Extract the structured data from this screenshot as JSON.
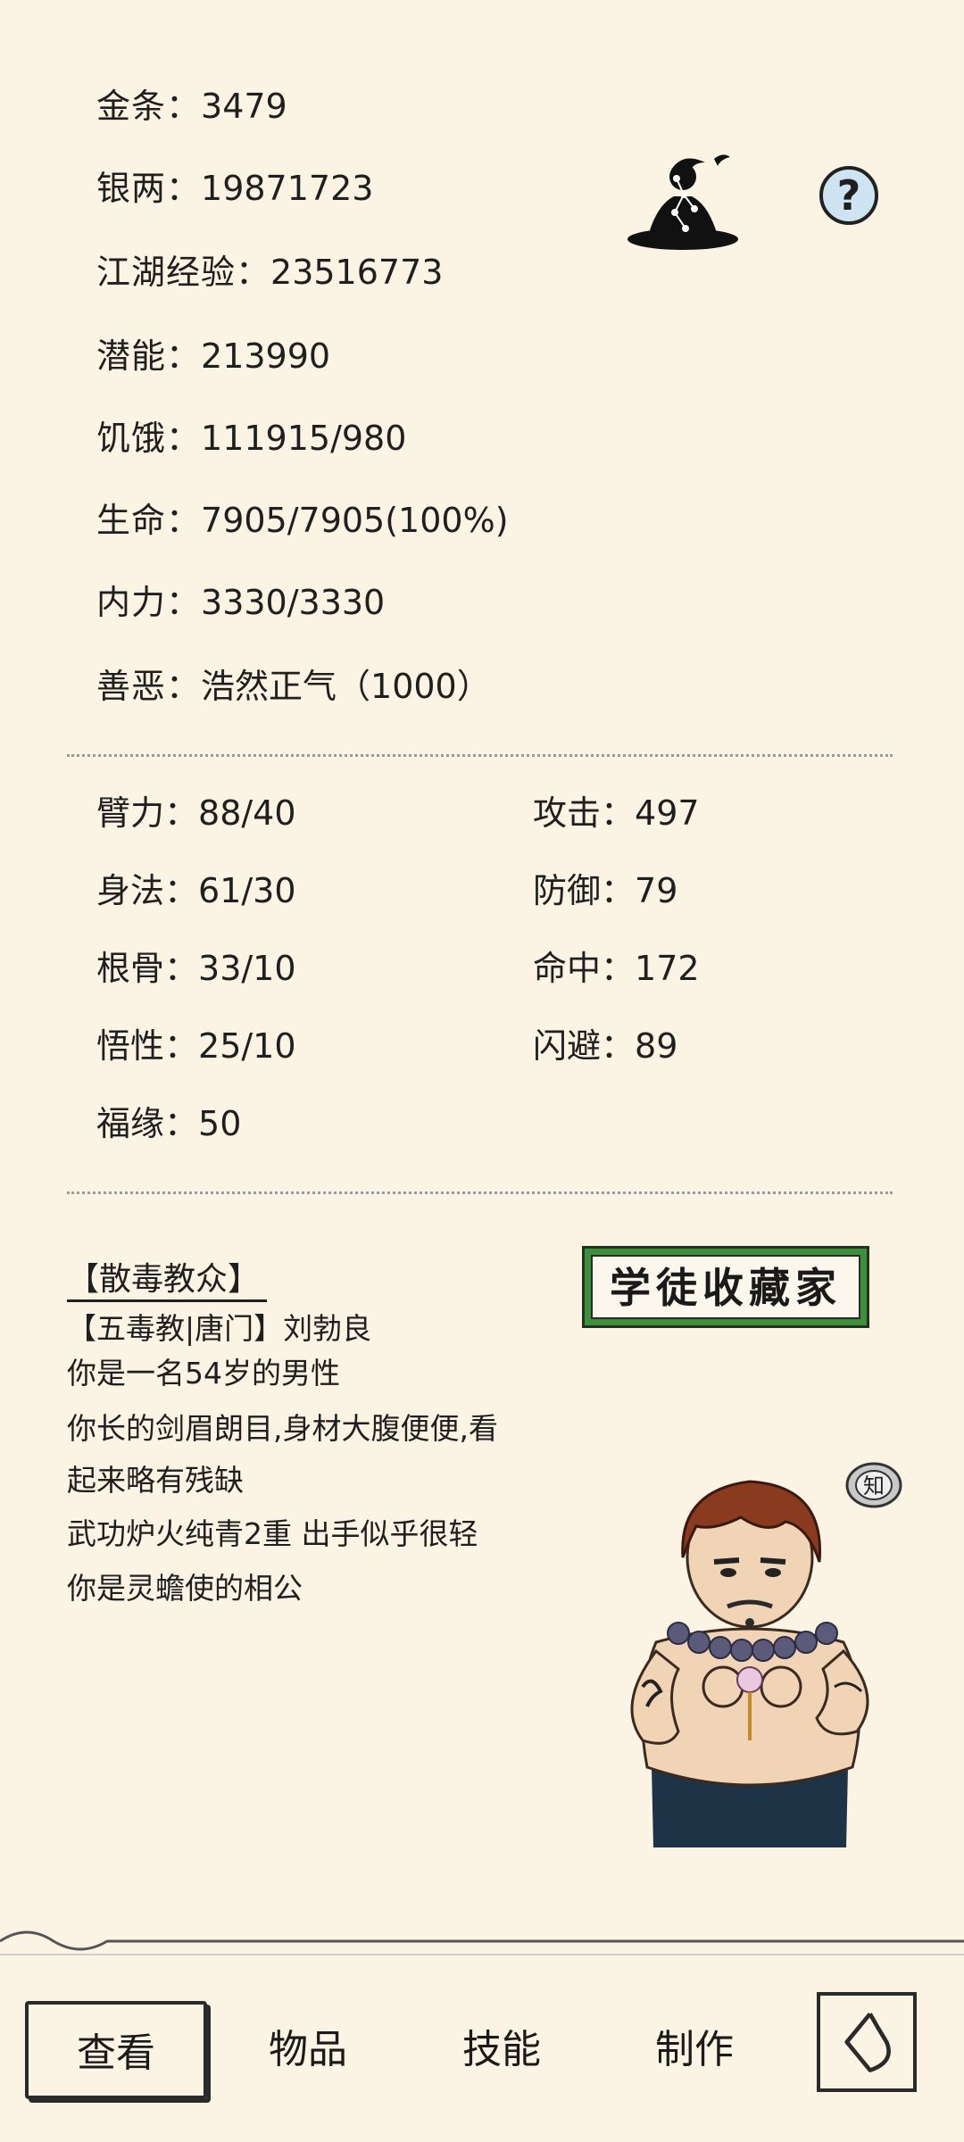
{
  "stats": [
    {
      "label": "金条：",
      "value": "3479"
    },
    {
      "label": "银两：",
      "value": "19871723"
    },
    {
      "label": "江湖经验：",
      "value": "23516773"
    },
    {
      "label": "潜能：",
      "value": "213990"
    },
    {
      "label": "饥饿：",
      "value": "111915/980"
    },
    {
      "label": "生命：",
      "value": "7905/7905(100%)"
    },
    {
      "label": "内力：",
      "value": "3330/3330"
    },
    {
      "label": "善恶：",
      "value": "浩然正气（1000）"
    }
  ],
  "attributes_left": [
    {
      "label": "臂力：",
      "value": "88/40"
    },
    {
      "label": "身法：",
      "value": "61/30"
    },
    {
      "label": "根骨：",
      "value": "33/10"
    },
    {
      "label": "悟性：",
      "value": "25/10"
    },
    {
      "label": "福缘：",
      "value": "50"
    }
  ],
  "attributes_right": [
    {
      "label": "攻击：",
      "value": "497"
    },
    {
      "label": "防御：",
      "value": "79"
    },
    {
      "label": "命中：",
      "value": "172"
    },
    {
      "label": "闪避：",
      "value": "89"
    }
  ],
  "help_label": "?",
  "faction_title": "【散毒教众】",
  "bio_lines": [
    "【五毒教|唐门】刘勃良",
    "你是一名54岁的男性",
    "你长的剑眉朗目,身材大腹便便,看",
    "起来略有残缺",
    "武功炉火纯青2重 出手似乎很轻",
    "你是灵蟾使的相公"
  ],
  "badge_text": "学徒收藏家",
  "zhi_label": "知",
  "nav": {
    "view": "查看",
    "items": "物品",
    "skills": "技能",
    "craft": "制作"
  },
  "colors": {
    "background": "#fbf3e3",
    "badge_green": "#3e8f3c",
    "help_blue": "#cfe4f3"
  }
}
